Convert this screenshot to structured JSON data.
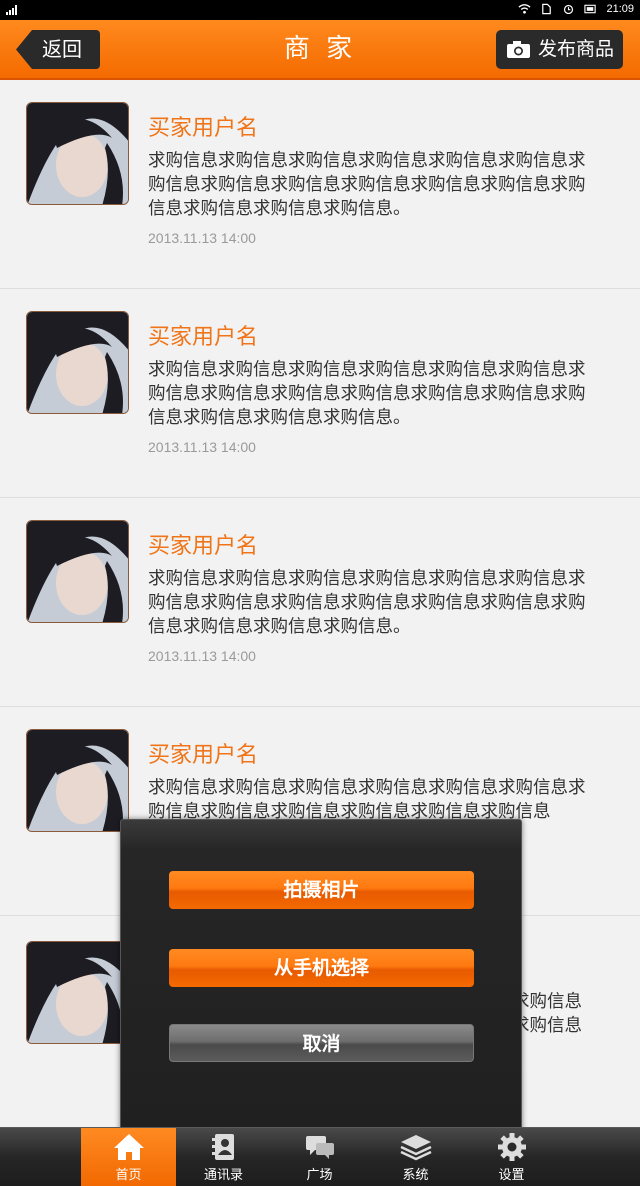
{
  "status_bar": {
    "time": "21:09"
  },
  "header": {
    "back_label": "返回",
    "title": "商 家",
    "publish_label": "发布商品"
  },
  "posts": [
    {
      "buyer": "买家用户名",
      "message": "求购信息求购信息求购信息求购信息求购信息求购信息求购信息求购信息求购信息求购信息求购信息求购信息求购信息求购信息求购信息求购信息。",
      "time": "2013.11.13 14:00"
    },
    {
      "buyer": "买家用户名",
      "message": "求购信息求购信息求购信息求购信息求购信息求购信息求购信息求购信息求购信息求购信息求购信息求购信息求购信息求购信息求购信息求购信息。",
      "time": "2013.11.13 14:00"
    },
    {
      "buyer": "买家用户名",
      "message": "求购信息求购信息求购信息求购信息求购信息求购信息求购信息求购信息求购信息求购信息求购信息求购信息求购信息求购信息求购信息求购信息。",
      "time": "2013.11.13 14:00"
    },
    {
      "buyer": "买家用户名",
      "message": "求购信息求购信息求购信息求购信息求购信息求购信息求购信息求购信息求购信息求购信息求购信息求购信息",
      "time": ""
    },
    {
      "buyer": "",
      "message": "求购信息求购信息",
      "time": ""
    }
  ],
  "dialog": {
    "take_photo": "拍摄相片",
    "choose_from_phone": "从手机选择",
    "cancel": "取消"
  },
  "tabs": [
    {
      "label": "首页",
      "icon": "home-icon",
      "active": true
    },
    {
      "label": "通讯录",
      "icon": "contacts-icon",
      "active": false
    },
    {
      "label": "广场",
      "icon": "chat-bubbles-icon",
      "active": false
    },
    {
      "label": "系统",
      "icon": "layers-icon",
      "active": false
    },
    {
      "label": "设置",
      "icon": "gear-icon",
      "active": false
    }
  ],
  "colors": {
    "accent": "#f46a00",
    "buyer_name": "#f07418",
    "dark_button": "#2a2a2a"
  }
}
